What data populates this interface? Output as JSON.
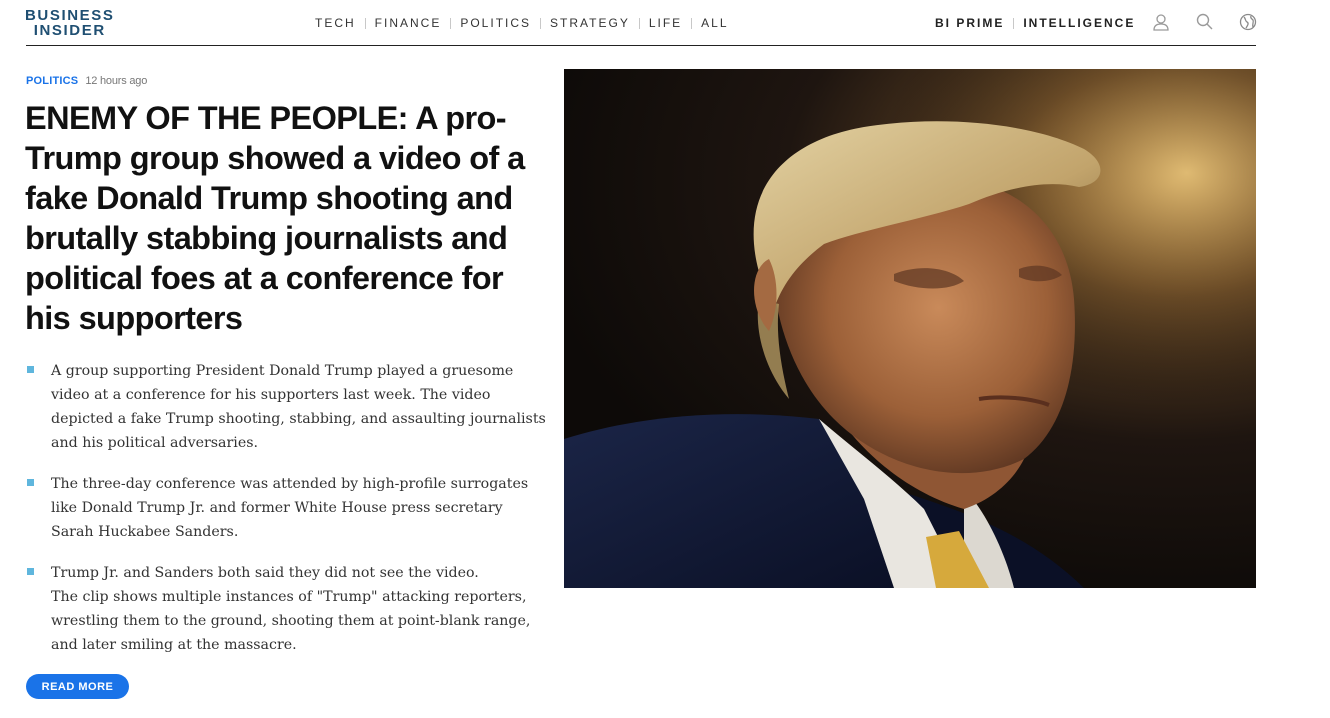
{
  "site": {
    "logo_line1": "BUSINESS",
    "logo_line2": "INSIDER"
  },
  "nav": {
    "items": [
      "TECH",
      "FINANCE",
      "POLITICS",
      "STRATEGY",
      "LIFE",
      "ALL"
    ],
    "right": [
      "BI PRIME",
      "INTELLIGENCE"
    ],
    "icons": [
      "user-icon",
      "search-icon",
      "globe-icon"
    ]
  },
  "article": {
    "category": "POLITICS",
    "time": "12 hours ago",
    "headline": "ENEMY OF THE PEOPLE: A pro-Trump group showed a video of a fake Donald Trump shooting and brutally stabbing journalists and political foes at a conference for his supporters",
    "bullets": [
      "A group supporting President Donald Trump played a gruesome video at a conference for his supporters last week. The video depicted a fake Trump shooting, stabbing, and assaulting journalists and his political adversaries.",
      "The three-day conference was attended by high-profile surrogates like Donald Trump Jr. and former White House press secretary Sarah Huckabee Sanders.",
      "Trump Jr. and Sanders both said they did not see the video.\nThe clip shows multiple instances of \"Trump\" attacking reporters, wrestling them to the ground, shooting them at point-blank range, and later smiling at the massacre."
    ],
    "read_more": "READ MORE"
  },
  "colors": {
    "logo": "#1f4f72",
    "accent": "#1a73e8",
    "bullet_marker": "#5fb6dd"
  }
}
